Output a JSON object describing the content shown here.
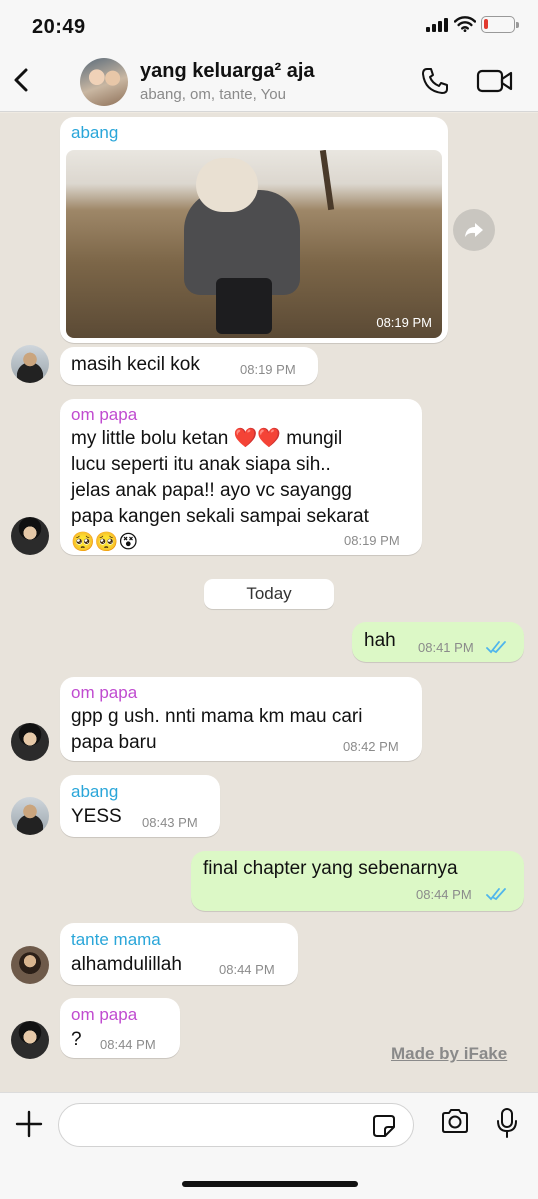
{
  "status_bar": {
    "time": "20:49",
    "battery_level": 0.15
  },
  "header": {
    "title": "yang keluarga² aja",
    "subtitle": "abang, om, tante, You"
  },
  "colors": {
    "abang": "#2aa6d9",
    "om_papa": "#c04bd0",
    "tante_mama": "#2aa6d9",
    "outgoing_bubble": "#dcf8c6",
    "read_ticks": "#4fb5ec"
  },
  "messages": {
    "m1": {
      "sender": "abang",
      "time": "08:19 PM",
      "type": "photo"
    },
    "m2": {
      "text": "masih kecil kok",
      "time": "08:19 PM"
    },
    "m3": {
      "sender": "om papa",
      "text": "my little bolu ketan ❤️❤️ mungil\nlucu seperti itu anak siapa sih..\njelas anak papa!! ayo vc sayangg\npapa kangen sekali sampai sekarat\n🥺🥺😵",
      "time": "08:19 PM"
    },
    "date_divider": "Today",
    "m4": {
      "text": "hah",
      "time": "08:41 PM"
    },
    "m5": {
      "sender": "om papa",
      "text": "gpp g ush. nnti mama km mau cari\npapa baru",
      "time": "08:42 PM"
    },
    "m6": {
      "sender": "abang",
      "text": "YESS",
      "time": "08:43 PM"
    },
    "m7": {
      "text": "final chapter yang sebenarnya",
      "time": "08:44 PM"
    },
    "m8": {
      "sender": "tante mama",
      "text": "alhamdulillah",
      "time": "08:44 PM"
    },
    "m9": {
      "sender": "om papa",
      "text": "?",
      "time": "08:44 PM"
    }
  },
  "watermark": "Made by iFake",
  "icons": {
    "back": "chevron-left-icon",
    "call": "phone-icon",
    "video": "video-camera-icon",
    "forward": "forward-arrow-icon",
    "plus": "plus-icon",
    "sticker": "sticker-icon",
    "camera": "camera-icon",
    "mic": "microphone-icon"
  }
}
